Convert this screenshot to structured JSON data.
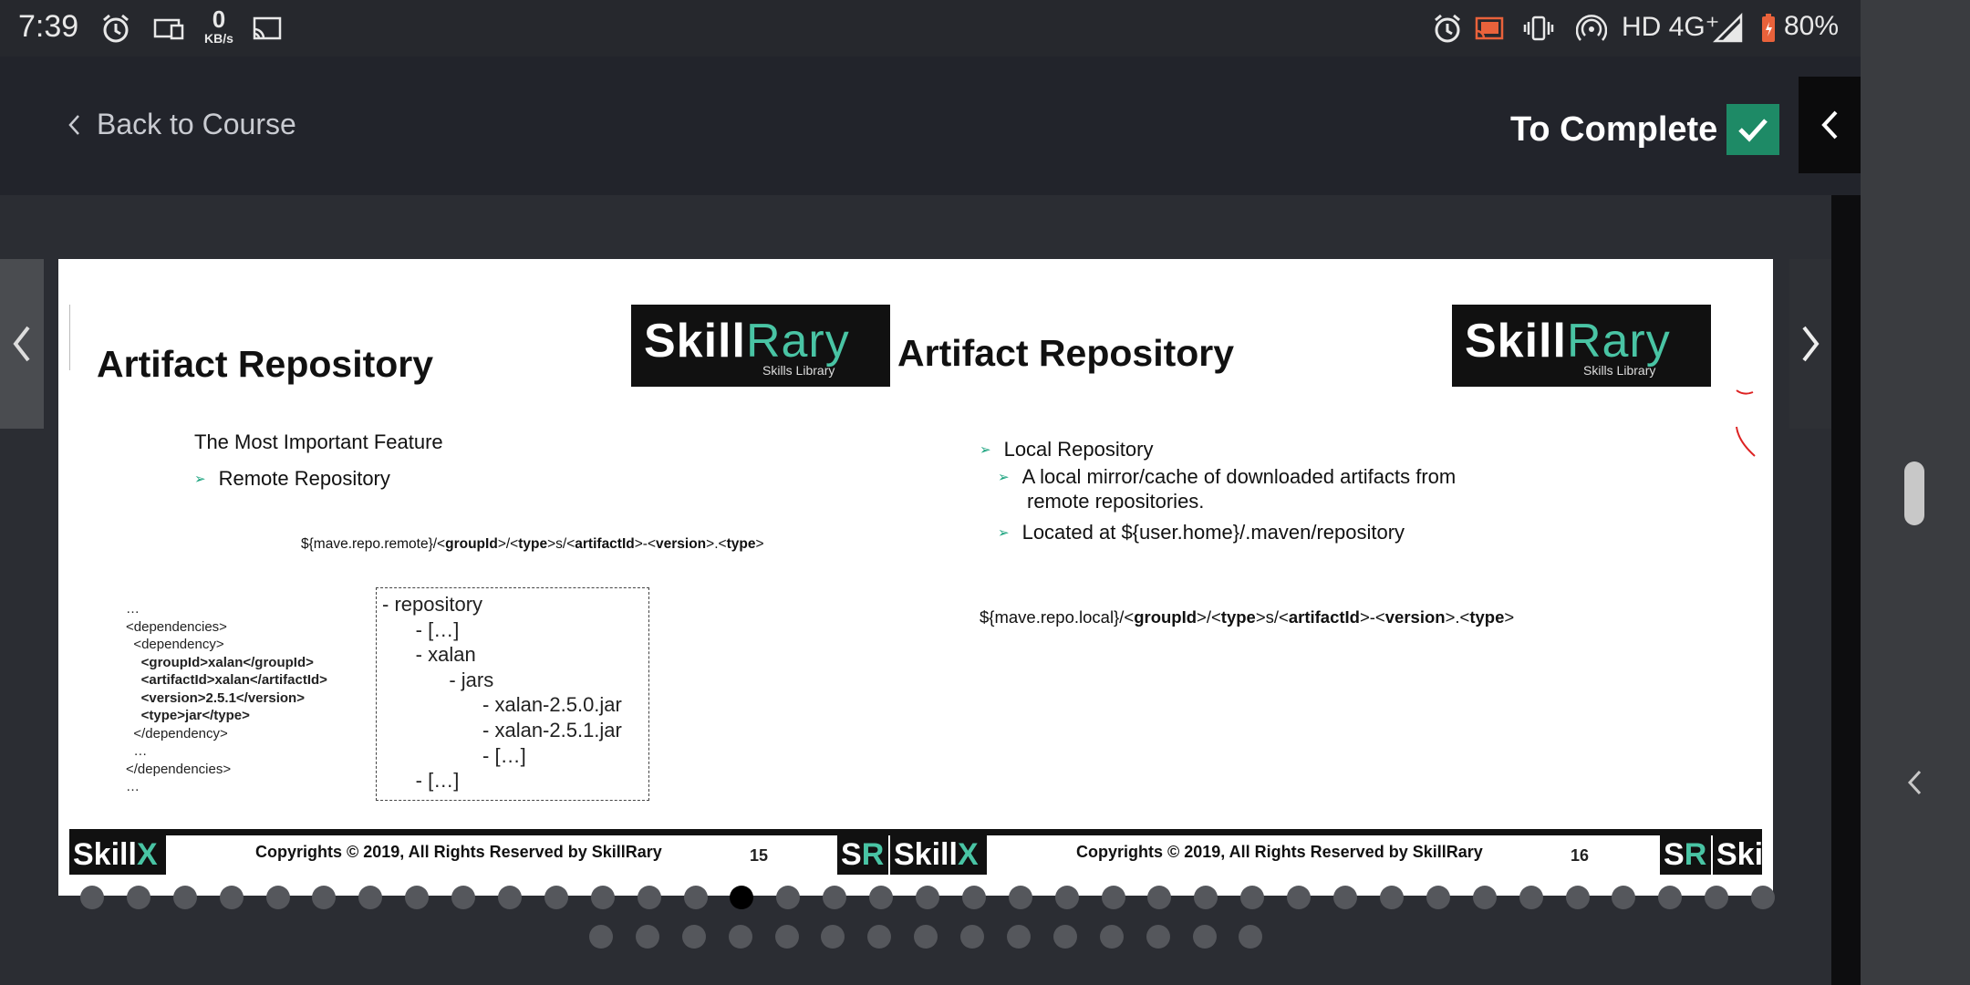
{
  "status_bar": {
    "time": "7:39",
    "speed_value": "0",
    "speed_unit": "KB/s",
    "network": "HD 4G⁺",
    "battery": "80%",
    "icons": [
      "alarm-icon",
      "screen-icon",
      "cast-icon",
      "alarm-icon",
      "cast-on-icon",
      "vibrate-icon",
      "hotspot-icon",
      "signal-icon",
      "battery-icon"
    ]
  },
  "header": {
    "back_label": "Back to Course",
    "complete_label": "To Complete",
    "accent_color": "#1e8a66"
  },
  "slide_left": {
    "title": "Artifact Repository",
    "feature_heading": "The Most Important Feature",
    "bullet": "Remote Repository",
    "path_parts": [
      "${mave.repo.remote}/<",
      "groupId",
      ">/<",
      "type",
      ">s/<",
      "artifactId",
      ">-<",
      "version",
      ">.<",
      "type",
      ">"
    ],
    "xml_lines": [
      "…",
      "<dependencies>",
      "  <dependency>",
      "    <groupId>xalan</groupId>",
      "    <artifactId>xalan</artifactId>",
      "    <version>2.5.1</version>",
      "    <type>jar</type>",
      "  </dependency>",
      "  …",
      "</dependencies>",
      "…"
    ],
    "tree_lines": [
      "- repository",
      "      - […]",
      "      - xalan",
      "            - jars",
      "                  - xalan-2.5.0.jar",
      "                  - xalan-2.5.1.jar",
      "                  - […]",
      "      - […]"
    ],
    "footer_copyright": "Copyrights © 2019, All Rights Reserved by SkillRary",
    "page_number": "15"
  },
  "slide_right": {
    "title": "Artifact Repository",
    "bullet_main": "Local Repository",
    "sub_bullet_1": "A local mirror/cache of downloaded artifacts from",
    "sub_bullet_1b": "remote repositories.",
    "sub_bullet_2": "Located at ${user.home}/.maven/repository",
    "path_parts": [
      "${mave.repo.local}/<",
      "groupId",
      ">/<",
      "type",
      ">s/<",
      "artifactId",
      ">-<",
      "version",
      ">.<",
      "type",
      ">"
    ],
    "footer_copyright": "Copyrights © 2019, All Rights Reserved by SkillRary",
    "page_number": "16"
  },
  "logos": {
    "skillrary_a": "Skill",
    "skillrary_b": "Rary",
    "skillrary_sub": "Skills Library",
    "skillx_a": "Skill",
    "skillx_b": "X",
    "sr_a": "S",
    "sr_b": "R",
    "ski": "Ski"
  },
  "pager": {
    "row1_count": 37,
    "row1_active_index": 14,
    "row2_count": 15
  }
}
